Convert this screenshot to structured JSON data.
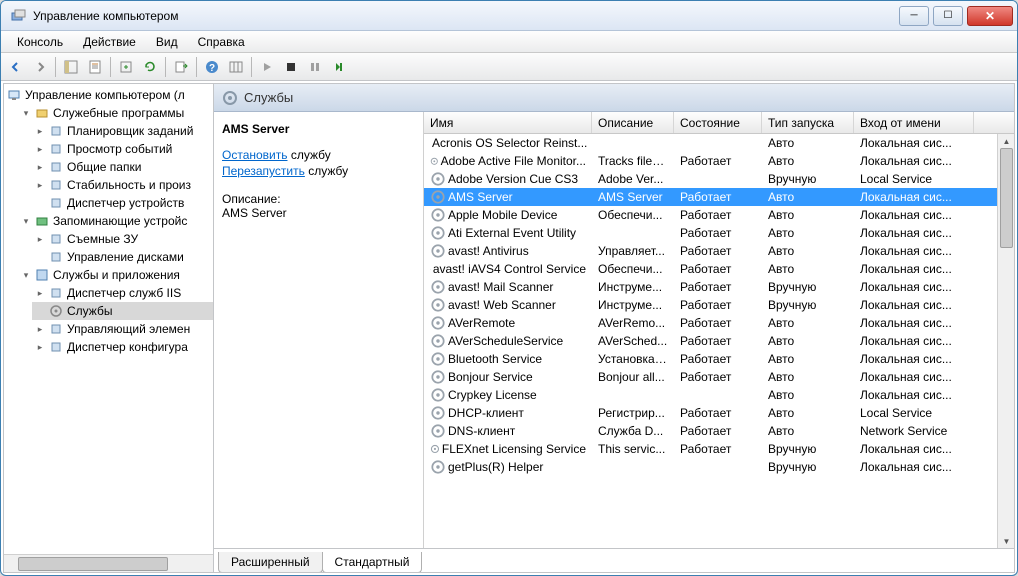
{
  "window": {
    "title": "Управление компьютером"
  },
  "menubar": [
    "Консоль",
    "Действие",
    "Вид",
    "Справка"
  ],
  "tree": {
    "root": {
      "label": "Управление компьютером (л"
    },
    "groups": [
      {
        "label": "Служебные программы",
        "items": [
          "Планировщик заданий",
          "Просмотр событий",
          "Общие папки",
          "Стабильность и произ",
          "Диспетчер устройств"
        ]
      },
      {
        "label": "Запоминающие устройс",
        "items": [
          "Съемные ЗУ",
          "Управление дисками"
        ]
      },
      {
        "label": "Службы и приложения",
        "items": [
          "Диспетчер служб IIS",
          "Службы",
          "Управляющий элемен",
          "Диспетчер конфигура"
        ],
        "selectedIndex": 1
      }
    ]
  },
  "panelTitle": "Службы",
  "detail": {
    "heading": "AMS Server",
    "stopLink": "Остановить",
    "stopSuffix": "службу",
    "restartLink": "Перезапустить",
    "restartSuffix": "службу",
    "descLabel": "Описание:",
    "descValue": "AMS Server"
  },
  "columns": [
    "Имя",
    "Описание",
    "Состояние",
    "Тип запуска",
    "Вход от имени"
  ],
  "selectedService": 3,
  "services": [
    {
      "name": "Acronis OS Selector Reinst...",
      "desc": "",
      "state": "",
      "start": "Авто",
      "login": "Локальная сис..."
    },
    {
      "name": "Adobe Active File Monitor...",
      "desc": "Tracks files...",
      "state": "Работает",
      "start": "Авто",
      "login": "Локальная сис..."
    },
    {
      "name": "Adobe Version Cue CS3",
      "desc": "Adobe Ver...",
      "state": "",
      "start": "Вручную",
      "login": "Local Service"
    },
    {
      "name": "AMS Server",
      "desc": "AMS Server",
      "state": "Работает",
      "start": "Авто",
      "login": "Локальная сис..."
    },
    {
      "name": "Apple Mobile Device",
      "desc": "Обеспечи...",
      "state": "Работает",
      "start": "Авто",
      "login": "Локальная сис..."
    },
    {
      "name": "Ati External Event Utility",
      "desc": "",
      "state": "Работает",
      "start": "Авто",
      "login": "Локальная сис..."
    },
    {
      "name": "avast! Antivirus",
      "desc": "Управляет...",
      "state": "Работает",
      "start": "Авто",
      "login": "Локальная сис..."
    },
    {
      "name": "avast! iAVS4 Control Service",
      "desc": "Обеспечи...",
      "state": "Работает",
      "start": "Авто",
      "login": "Локальная сис..."
    },
    {
      "name": "avast! Mail Scanner",
      "desc": "Инструме...",
      "state": "Работает",
      "start": "Вручную",
      "login": "Локальная сис..."
    },
    {
      "name": "avast! Web Scanner",
      "desc": "Инструме...",
      "state": "Работает",
      "start": "Вручную",
      "login": "Локальная сис..."
    },
    {
      "name": "AVerRemote",
      "desc": "AVerRemo...",
      "state": "Работает",
      "start": "Авто",
      "login": "Локальная сис..."
    },
    {
      "name": "AVerScheduleService",
      "desc": "AVerSched...",
      "state": "Работает",
      "start": "Авто",
      "login": "Локальная сис..."
    },
    {
      "name": "Bluetooth Service",
      "desc": "Установка ...",
      "state": "Работает",
      "start": "Авто",
      "login": "Локальная сис..."
    },
    {
      "name": "Bonjour Service",
      "desc": "Bonjour all...",
      "state": "Работает",
      "start": "Авто",
      "login": "Локальная сис..."
    },
    {
      "name": "Crypkey License",
      "desc": "",
      "state": "",
      "start": "Авто",
      "login": "Локальная сис..."
    },
    {
      "name": "DHCP-клиент",
      "desc": "Регистрир...",
      "state": "Работает",
      "start": "Авто",
      "login": "Local Service"
    },
    {
      "name": "DNS-клиент",
      "desc": "Служба D...",
      "state": "Работает",
      "start": "Авто",
      "login": "Network Service"
    },
    {
      "name": "FLEXnet Licensing Service",
      "desc": "This servic...",
      "state": "Работает",
      "start": "Вручную",
      "login": "Локальная сис..."
    },
    {
      "name": "getPlus(R) Helper",
      "desc": "",
      "state": "",
      "start": "Вручную",
      "login": "Локальная сис..."
    }
  ],
  "tabs": {
    "extended": "Расширенный",
    "standard": "Стандартный"
  }
}
